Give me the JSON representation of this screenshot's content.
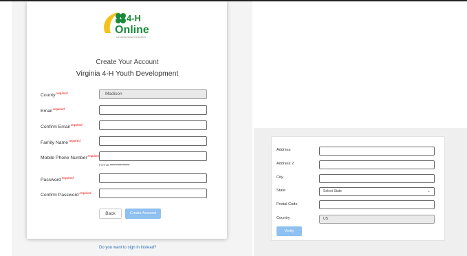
{
  "logo": {
    "text_top": "4-H",
    "text_bottom": "Online",
    "tagline": "A 4HONLINE PROJECT INNOVATION",
    "colors": {
      "green": "#1a8a3a",
      "yellow": "#f4c21b"
    }
  },
  "heading": "Create Your Account",
  "subheading": "Virginia 4-H Youth Development",
  "required_tag": "required",
  "fields": {
    "county": {
      "label": "County",
      "value": "Madison"
    },
    "email": {
      "label": "Email",
      "value": ""
    },
    "confirm_email": {
      "label": "Confirm Email",
      "value": ""
    },
    "family_name": {
      "label": "Family Name",
      "value": ""
    },
    "mobile_phone": {
      "label": "Mobile Phone Number",
      "value": "",
      "hint_prefix": "Format",
      "hint_format": "###-###-####"
    },
    "password": {
      "label": "Password",
      "value": ""
    },
    "confirm_password": {
      "label": "Confirm Password",
      "value": ""
    }
  },
  "buttons": {
    "back": "Back",
    "create": "Create Account"
  },
  "signin_link": "Do you want to sign in instead?",
  "address_form": {
    "address": {
      "label": "Address",
      "value": ""
    },
    "address2": {
      "label": "Address 2",
      "value": ""
    },
    "city": {
      "label": "City",
      "value": ""
    },
    "state": {
      "label": "State",
      "value": "Select State"
    },
    "postal_code": {
      "label": "Postal Code",
      "value": ""
    },
    "country": {
      "label": "Country",
      "value": "US"
    },
    "verify": "Verify"
  },
  "colors": {
    "accent_button": "#8ec0f0",
    "required": "#ee0000",
    "link": "#2a6ebb"
  }
}
